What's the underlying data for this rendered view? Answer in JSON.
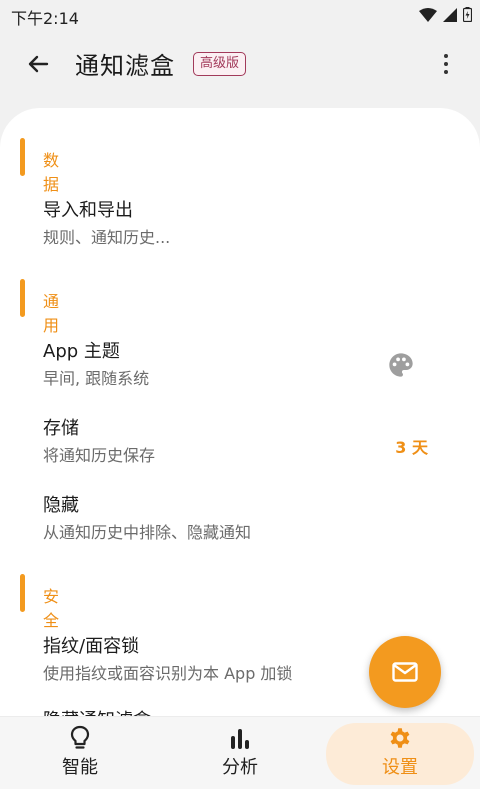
{
  "status": {
    "time": "下午2:14"
  },
  "appbar": {
    "title": "通知滤盒",
    "badge": "高级版"
  },
  "sections": [
    {
      "label": "数据"
    },
    {
      "label": "通用"
    },
    {
      "label": "安全"
    }
  ],
  "items": {
    "import_export": {
      "title": "导入和导出",
      "subtitle": "规则、通知历史..."
    },
    "theme": {
      "title": "App 主题",
      "subtitle": "早间, 跟随系统"
    },
    "storage": {
      "title": "存储",
      "subtitle": "将通知历史保存",
      "trailing": "3 天"
    },
    "hide": {
      "title": "隐藏",
      "subtitle": "从通知历史中排除、隐藏通知"
    },
    "lock": {
      "title": "指纹/面容锁",
      "subtitle": "使用指纹或面容识别为本 App 加锁"
    },
    "hidden_box": {
      "title": "隐藏通知滤盒"
    }
  },
  "nav": [
    {
      "label": "智能",
      "icon": "lightbulb-icon"
    },
    {
      "label": "分析",
      "icon": "bar-chart-icon"
    },
    {
      "label": "设置",
      "icon": "gear-icon",
      "active": true
    }
  ],
  "colors": {
    "accent": "#f39a1f",
    "badge": "#a23a5a",
    "active_bg": "#fdebd7"
  }
}
